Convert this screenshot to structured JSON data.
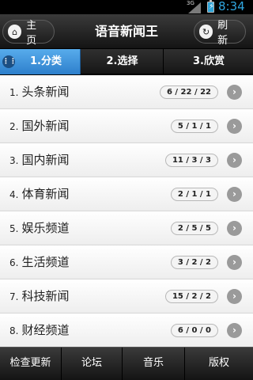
{
  "status_bar": {
    "network": "3G",
    "time": "8:34"
  },
  "title_bar": {
    "home_label": "主页",
    "title": "语音新闻王",
    "refresh_label": "刷新"
  },
  "tabs": [
    {
      "label": "1.分类"
    },
    {
      "label": "2.选择"
    },
    {
      "label": "3.欣赏"
    }
  ],
  "categories": [
    {
      "num": "1.",
      "name": "头条新闻",
      "count": "6 / 22 / 22"
    },
    {
      "num": "2.",
      "name": "国外新闻",
      "count": "5 / 1 / 1"
    },
    {
      "num": "3.",
      "name": "国内新闻",
      "count": "11 / 3 / 3"
    },
    {
      "num": "4.",
      "name": "体育新闻",
      "count": "2 / 1 / 1"
    },
    {
      "num": "5.",
      "name": "娱乐频道",
      "count": "2 / 5 / 5"
    },
    {
      "num": "6.",
      "name": "生活频道",
      "count": "3 / 2 / 2"
    },
    {
      "num": "7.",
      "name": "科技新闻",
      "count": "15 / 2 / 2"
    },
    {
      "num": "8.",
      "name": "财经频道",
      "count": "6 / 0 / 0"
    }
  ],
  "bottom_bar": [
    {
      "label": "检查更新"
    },
    {
      "label": "论坛"
    },
    {
      "label": "音乐"
    },
    {
      "label": "版权"
    }
  ],
  "colors": {
    "accent": "#2d7fcc",
    "status_time": "#30a6e0"
  }
}
